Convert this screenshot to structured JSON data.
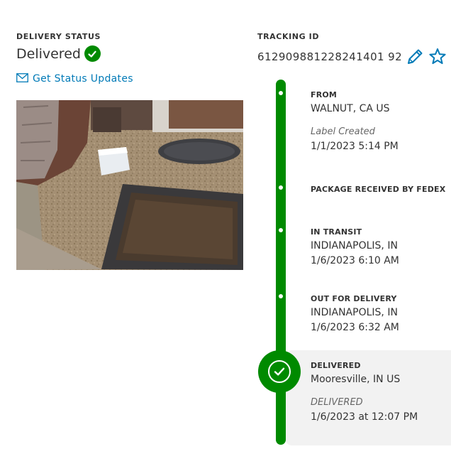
{
  "delivery_status": {
    "label": "DELIVERY STATUS",
    "status": "Delivered",
    "status_icon": "check-circle-icon",
    "updates_icon": "envelope-icon",
    "updates_link": "Get Status Updates"
  },
  "photo": {
    "alt": "Delivery photo of package on porch"
  },
  "tracking": {
    "label": "TRACKING ID",
    "number": "612909881228241401 92",
    "edit_icon": "pencil-icon",
    "favorite_icon": "star-icon"
  },
  "timeline": {
    "accent": "#008a00",
    "events": [
      {
        "title": "FROM",
        "location": "WALNUT, CA US",
        "note": "Label Created",
        "datetime": "1/1/2023 5:14 PM"
      },
      {
        "title": "PACKAGE RECEIVED BY FEDEX"
      },
      {
        "title": "IN TRANSIT",
        "location": "INDIANAPOLIS, IN",
        "datetime": "1/6/2023 6:10 AM"
      },
      {
        "title": "OUT FOR DELIVERY",
        "location": "INDIANAPOLIS, IN",
        "datetime": "1/6/2023 6:32 AM"
      },
      {
        "title": "DELIVERED",
        "location": "Mooresville, IN US",
        "note": "DELIVERED",
        "datetime": "1/6/2023 at 12:07 PM"
      }
    ]
  }
}
